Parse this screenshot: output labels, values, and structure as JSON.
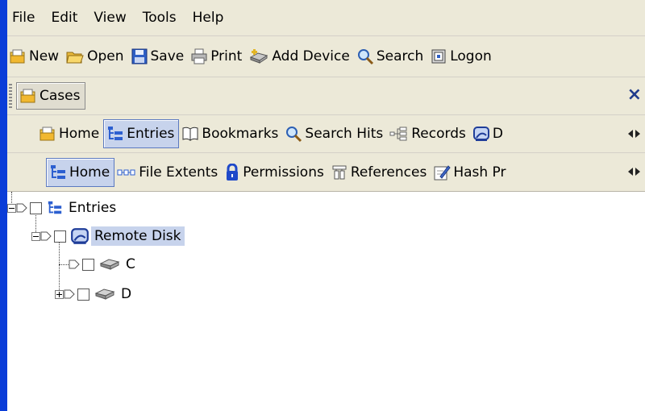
{
  "menu": [
    "File",
    "Edit",
    "View",
    "Tools",
    "Help"
  ],
  "toolbar": {
    "new": "New",
    "open": "Open",
    "save": "Save",
    "print": "Print",
    "add_device": "Add Device",
    "search": "Search",
    "logon": "Logon"
  },
  "cases": {
    "label": "Cases",
    "close": "×"
  },
  "tabs": {
    "home": "Home",
    "entries": "Entries",
    "bookmarks": "Bookmarks",
    "search_hits": "Search Hits",
    "records": "Records",
    "device_truncated": "D"
  },
  "subtabs": {
    "home": "Home",
    "file_extents": "File Extents",
    "permissions": "Permissions",
    "references": "References",
    "hash_truncated": "Hash Pr"
  },
  "tree": {
    "root": "Entries",
    "remote_disk": "Remote Disk",
    "drive_c": "C",
    "drive_d": "D"
  },
  "colors": {
    "titlebar_blue": "#0a3dd8",
    "chrome": "#ece9d8",
    "selection": "#c7d3ec"
  }
}
